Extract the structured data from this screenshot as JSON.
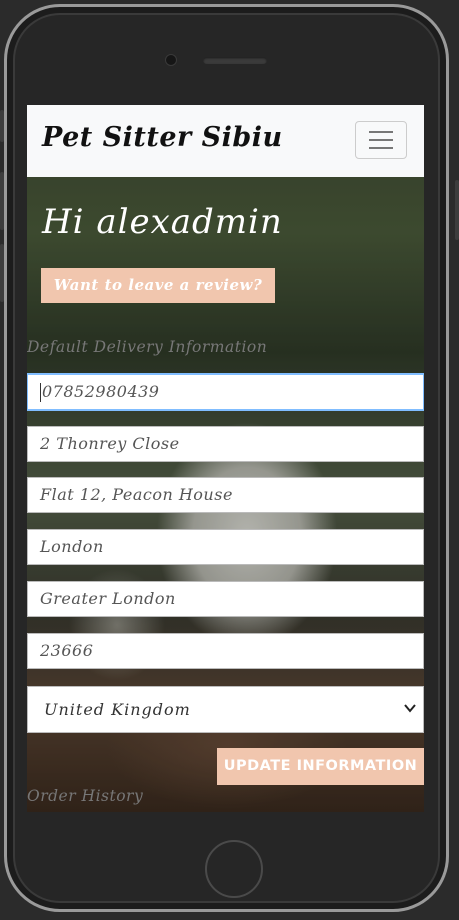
{
  "navbar": {
    "brand": "Pet Sitter Sibiu",
    "menu_icon": "hamburger-menu-icon"
  },
  "greeting": "Hi alexadmin",
  "review_button": "Want to leave a review?",
  "delivery_section": {
    "title": "Default Delivery Information",
    "fields": {
      "phone": "07852980439",
      "street1": "2 Thonrey Close",
      "street2": "Flat 12, Peacon House",
      "town": "London",
      "county": "Greater London",
      "postcode": "23666"
    },
    "country": "United Kingdom"
  },
  "update_button": "UPDATE INFORMATION",
  "order_history_title": "Order History",
  "colors": {
    "accent": "#f1c6ae",
    "navbar_bg": "#f8f9fa"
  }
}
